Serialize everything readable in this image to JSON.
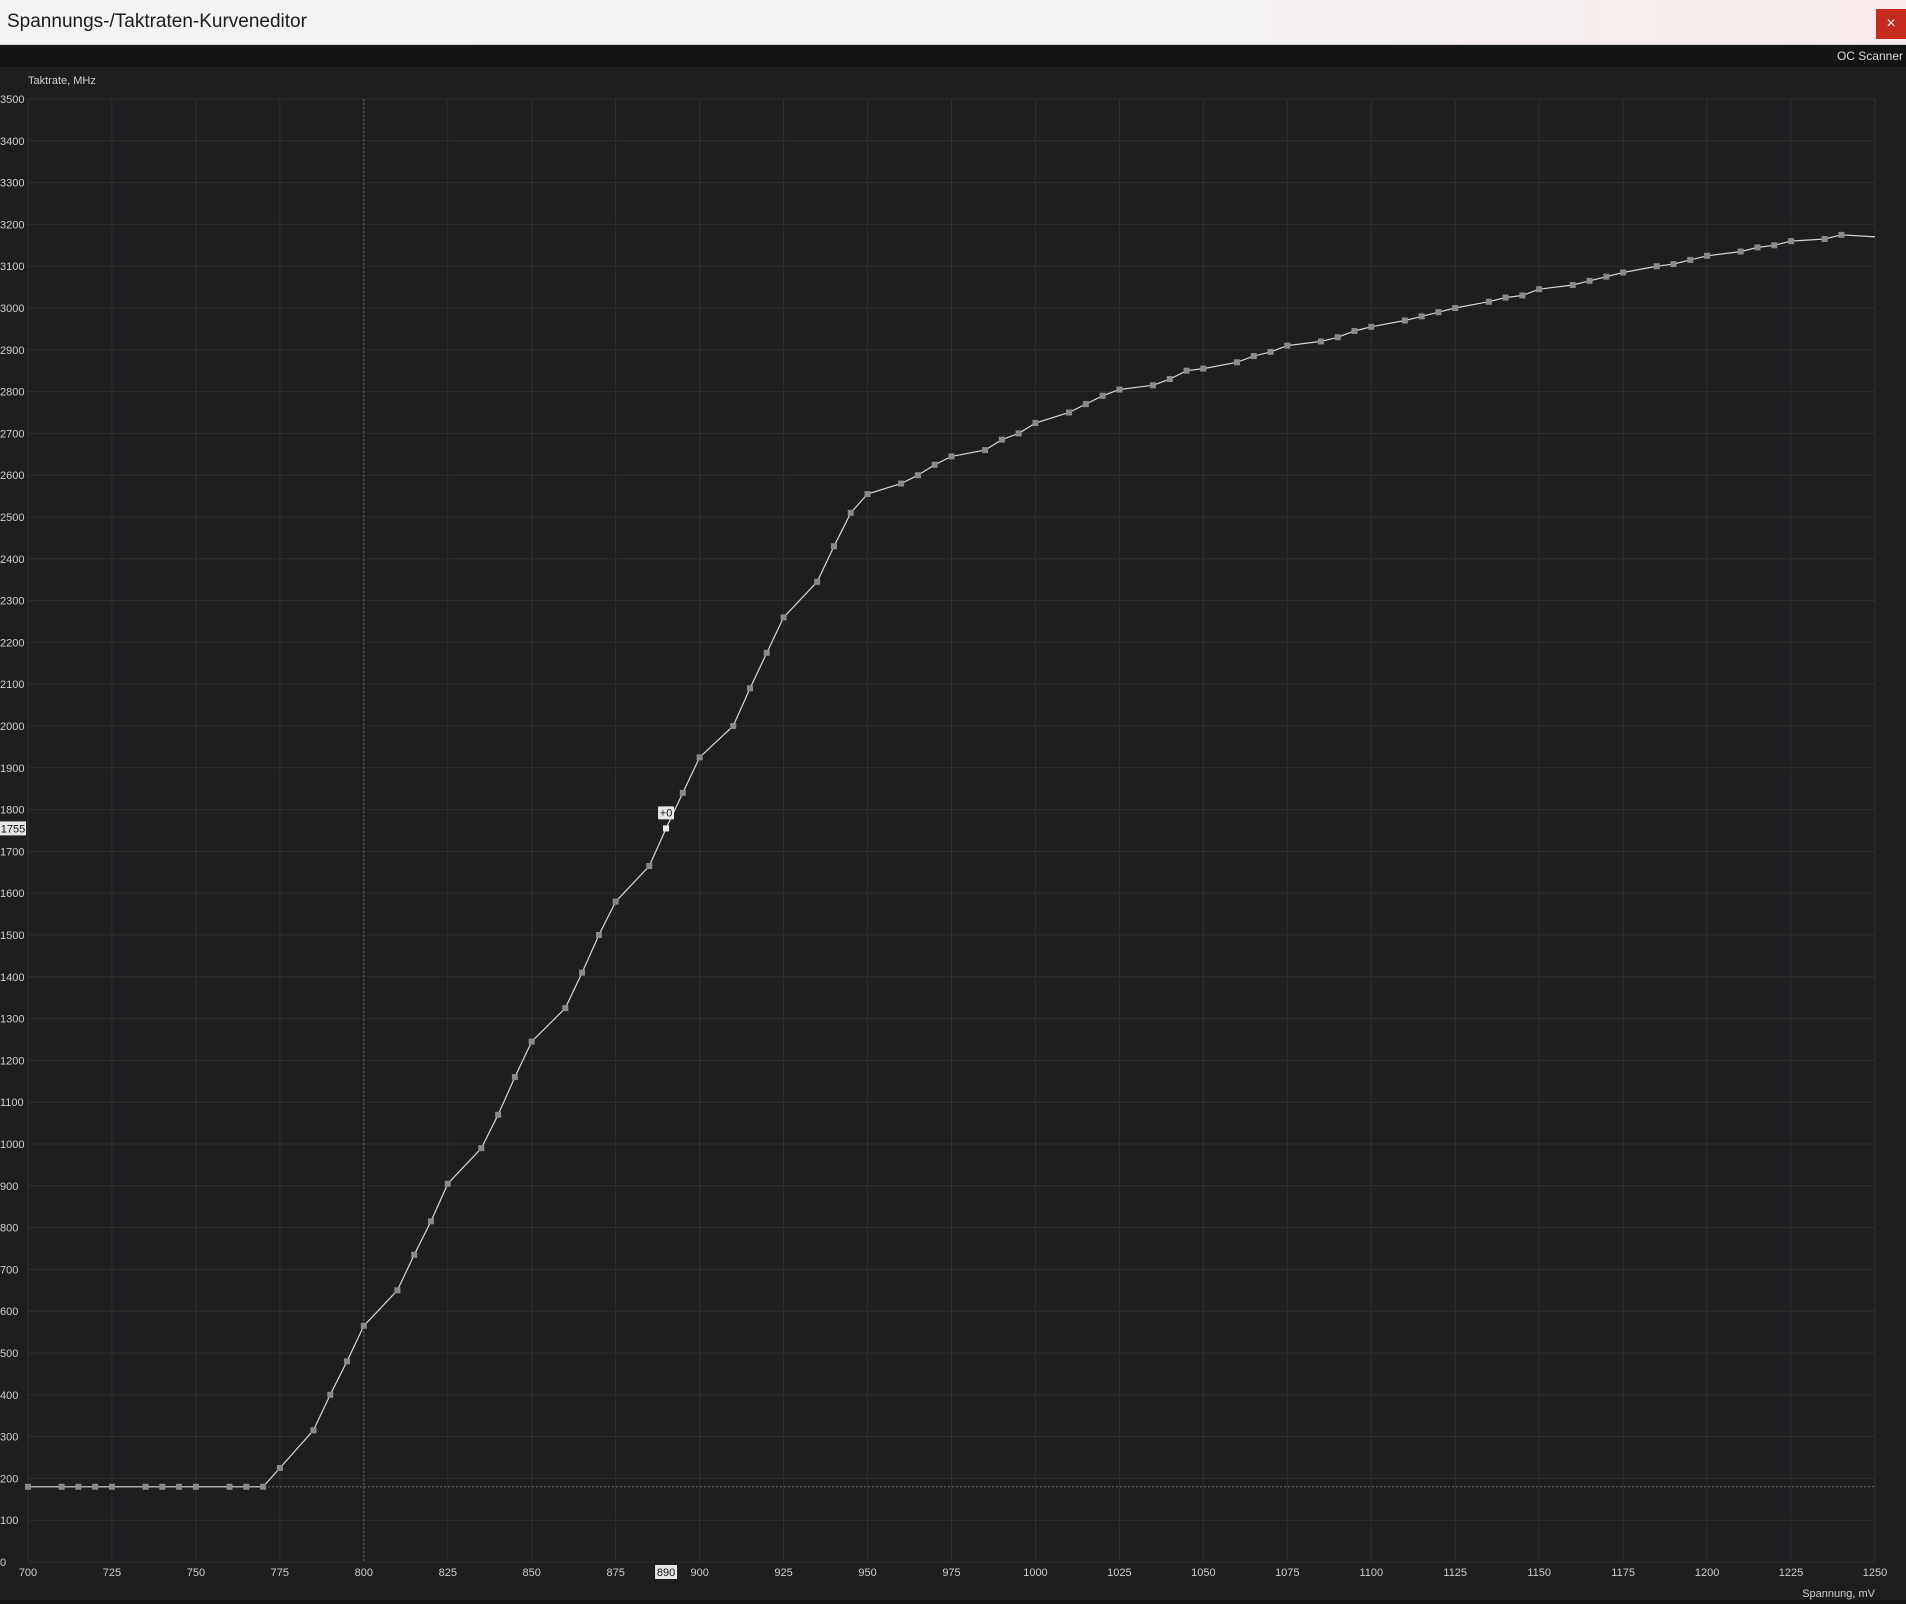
{
  "window": {
    "title": "Spannungs-/Taktraten-Kurveneditor",
    "close_label": "×"
  },
  "toolbar": {
    "oc_scanner_label": "OC Scanner"
  },
  "chart_data": {
    "type": "line",
    "ylabel": "Taktrate, MHz",
    "xlabel": "Spannung, mV",
    "xlim": [
      700,
      1250
    ],
    "ylim": [
      0,
      3500
    ],
    "x_ticks": [
      700,
      725,
      750,
      775,
      800,
      825,
      850,
      875,
      900,
      925,
      950,
      975,
      1000,
      1025,
      1050,
      1075,
      1100,
      1125,
      1150,
      1175,
      1200,
      1225,
      1250
    ],
    "y_ticks": [
      0,
      100,
      200,
      300,
      400,
      500,
      600,
      700,
      800,
      900,
      1000,
      1100,
      1200,
      1300,
      1400,
      1500,
      1600,
      1700,
      1800,
      1900,
      2000,
      2100,
      2200,
      2300,
      2400,
      2500,
      2600,
      2700,
      2800,
      2900,
      3000,
      3100,
      3200,
      3300,
      3400,
      3500
    ],
    "grid": true,
    "series": [
      {
        "x": [
          700,
          710,
          715,
          720,
          725,
          735,
          740,
          745,
          750,
          760,
          765,
          770,
          775,
          785,
          790,
          795,
          800,
          810,
          815,
          820,
          825,
          835,
          840,
          845,
          850,
          860,
          865,
          870,
          875,
          885,
          890,
          895,
          900,
          910,
          915,
          920,
          925,
          935,
          940,
          945,
          950,
          960,
          965,
          970,
          975,
          985,
          990,
          995,
          1000,
          1010,
          1015,
          1020,
          1025,
          1035,
          1040,
          1045,
          1050,
          1060,
          1065,
          1070,
          1075,
          1085,
          1090,
          1095,
          1100,
          1110,
          1115,
          1120,
          1125,
          1135,
          1140,
          1145,
          1150,
          1160,
          1165,
          1170,
          1175,
          1185,
          1190,
          1195,
          1200,
          1210,
          1215,
          1220,
          1225,
          1235,
          1240,
          1250
        ],
        "y": [
          180,
          180,
          180,
          180,
          180,
          180,
          180,
          180,
          180,
          180,
          180,
          180,
          225,
          315,
          400,
          480,
          565,
          650,
          735,
          815,
          905,
          990,
          1070,
          1160,
          1245,
          1325,
          1410,
          1500,
          1580,
          1665,
          1755,
          1840,
          1925,
          2000,
          2090,
          2175,
          2260,
          2345,
          2430,
          2510,
          2555,
          2580,
          2600,
          2625,
          2645,
          2660,
          2685,
          2700,
          2725,
          2750,
          2770,
          2790,
          2805,
          2815,
          2830,
          2850,
          2855,
          2870,
          2885,
          2895,
          2910,
          2920,
          2930,
          2945,
          2955,
          2970,
          2980,
          2990,
          3000,
          3015,
          3025,
          3030,
          3045,
          3055,
          3065,
          3075,
          3085,
          3100,
          3105,
          3115,
          3125,
          3135,
          3145,
          3150,
          3160,
          3165,
          3175,
          3170
        ]
      }
    ],
    "selected": {
      "x": 890,
      "y": 1755,
      "offset_label": "+0",
      "x_label": "890",
      "y_label": "1755"
    },
    "vertical_marker_x": 800,
    "horizontal_marker_y": 180
  },
  "colors": {
    "background": "#1e1e20",
    "grid": "#2e2e31",
    "line": "#d8d8d8",
    "point": "#8a8a8a",
    "close_button": "#c42b1c"
  }
}
